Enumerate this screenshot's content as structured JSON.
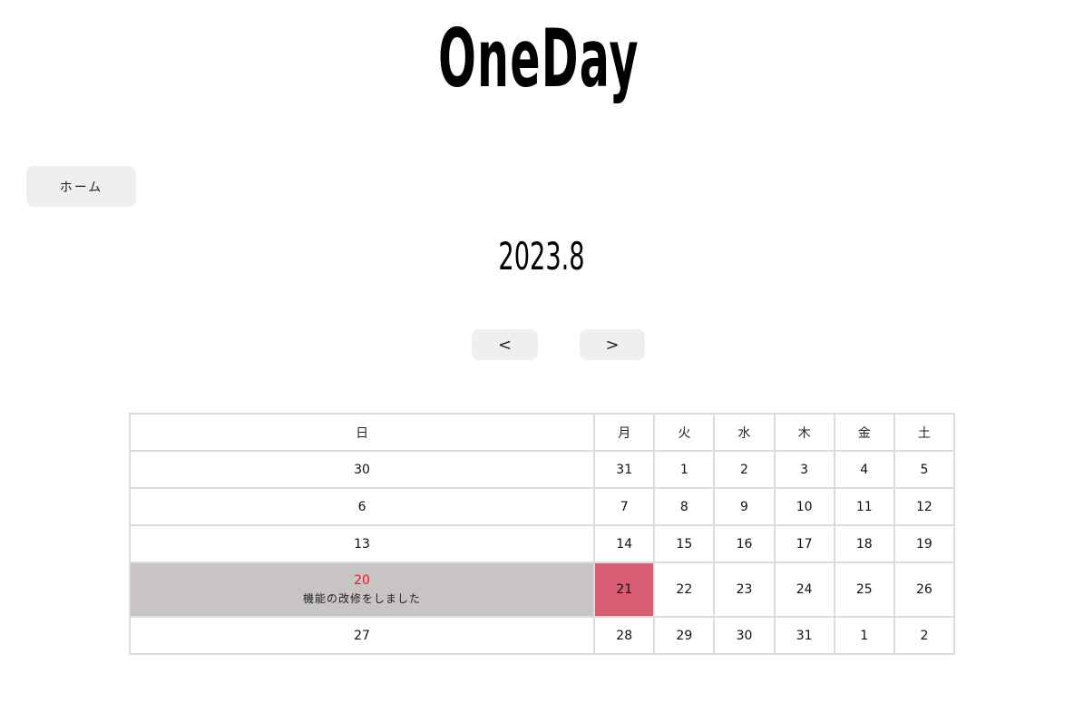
{
  "app": {
    "logo": "OneDay",
    "home_button": "ホーム",
    "month_title": "2023.8",
    "prev_label": "<",
    "next_label": ">"
  },
  "calendar": {
    "weekdays": [
      "日",
      "月",
      "火",
      "水",
      "木",
      "金",
      "土"
    ],
    "weeks": [
      [
        "30",
        "31",
        "1",
        "2",
        "3",
        "4",
        "5"
      ],
      [
        "6",
        "7",
        "8",
        "9",
        "10",
        "11",
        "12"
      ],
      [
        "13",
        "14",
        "15",
        "16",
        "17",
        "18",
        "19"
      ],
      [
        "20",
        "21",
        "22",
        "23",
        "24",
        "25",
        "26"
      ],
      [
        "27",
        "28",
        "29",
        "30",
        "31",
        "1",
        "2"
      ]
    ],
    "event_text": "機能の改修をしました",
    "colors": {
      "sunday": "#e8192c",
      "saturday": "#1a1ad8",
      "other_month": "#bdbdbd",
      "today_bg": "#d85c72",
      "selected_bg": "#c8c4c4"
    }
  }
}
